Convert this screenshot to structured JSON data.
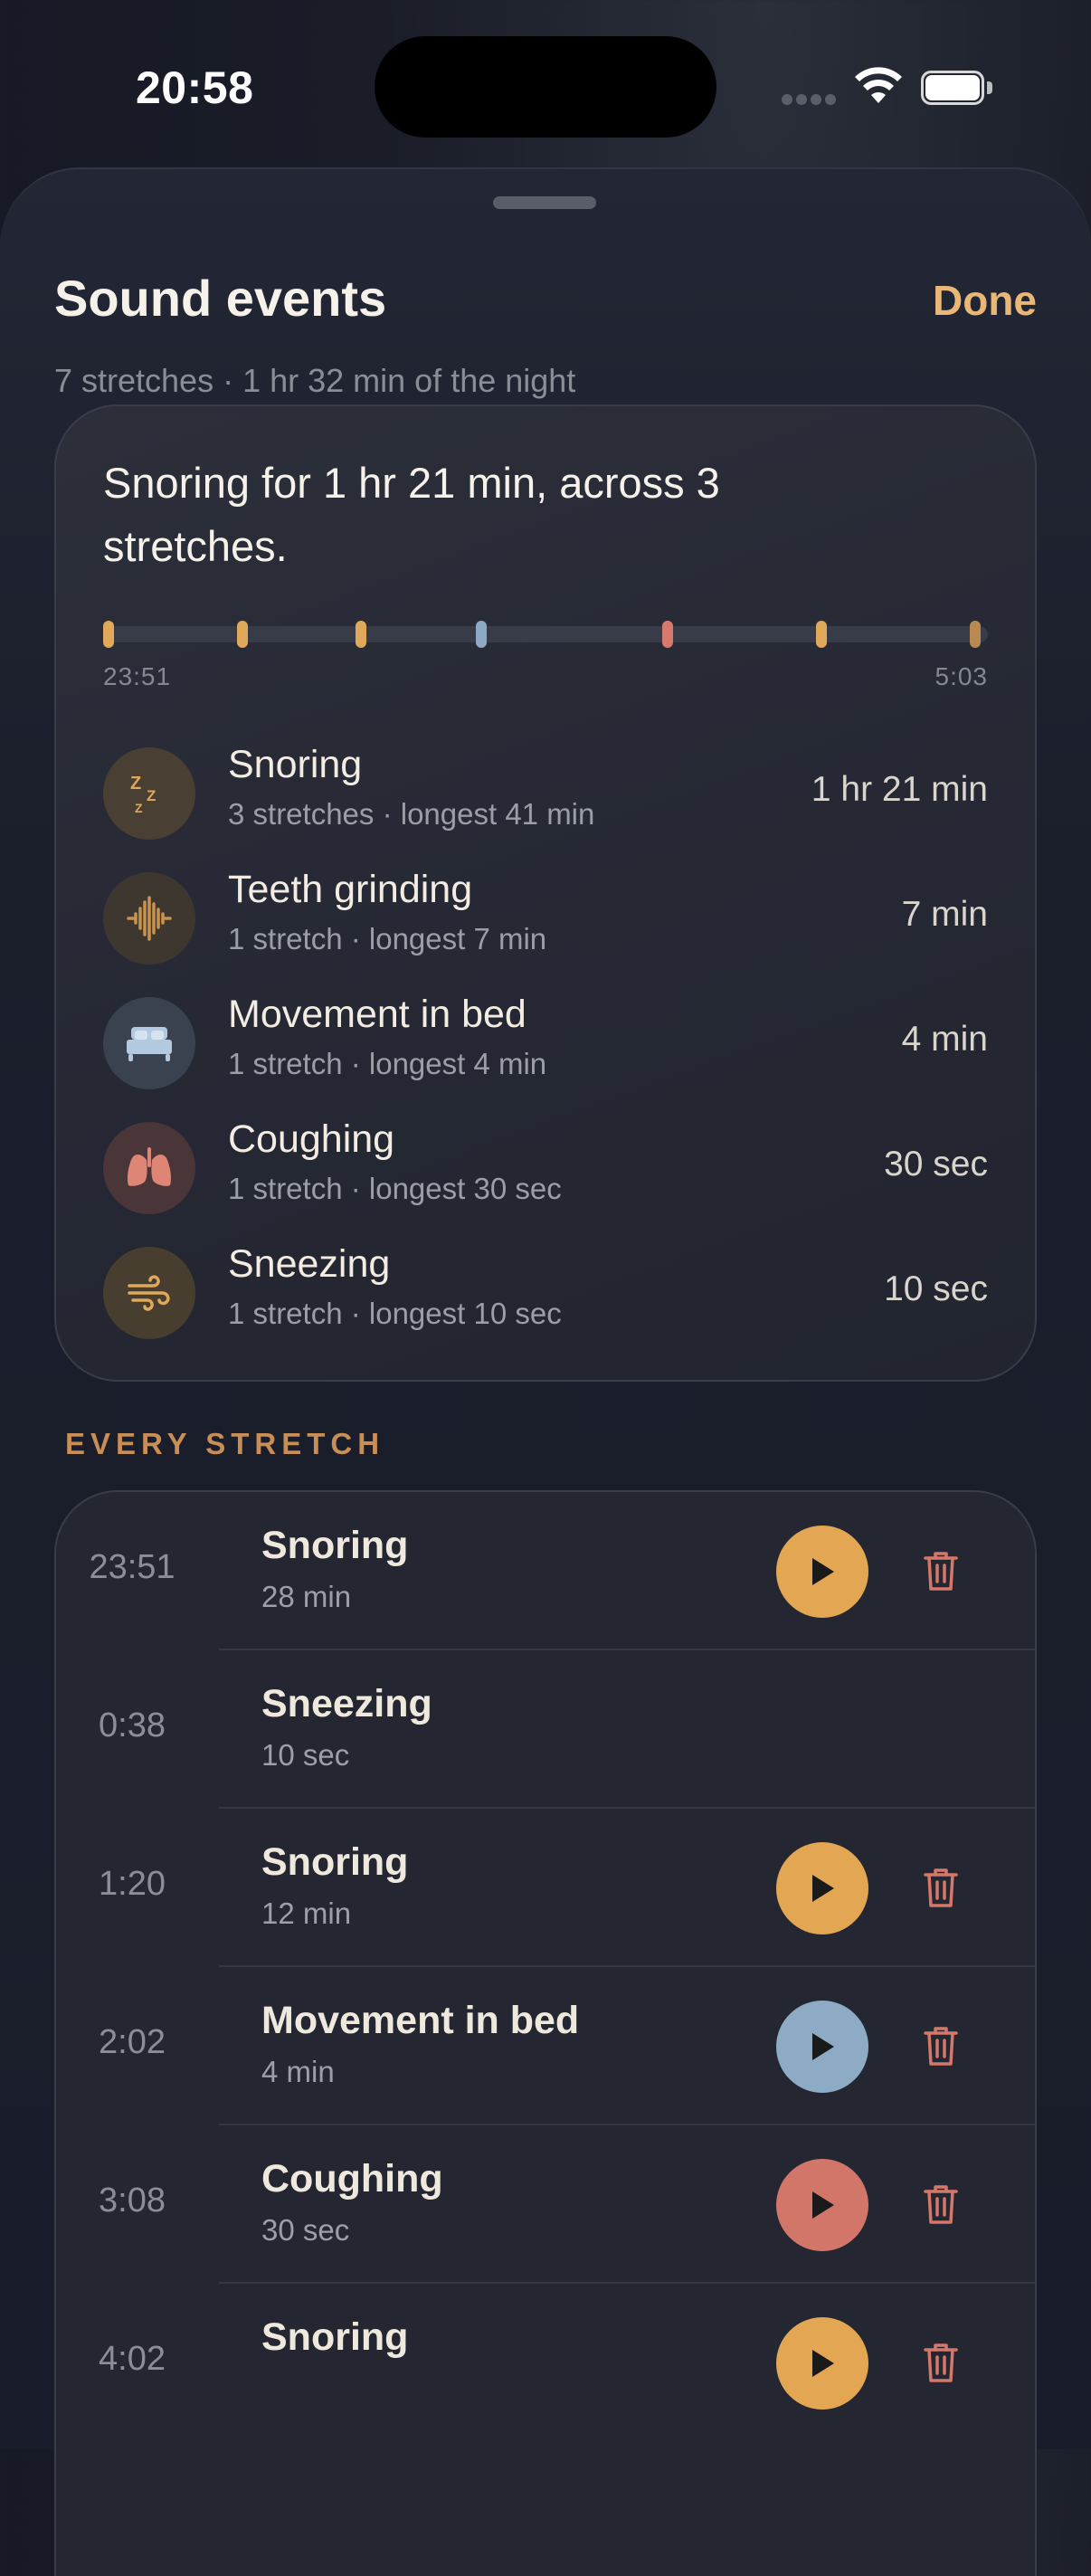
{
  "status_bar": {
    "time": "20:58"
  },
  "sheet": {
    "title": "Sound events",
    "done_label": "Done",
    "subtitle": "7 stretches · 1 hr 32 min of the night"
  },
  "summary": {
    "headline": "Snoring for 1 hr 21 min, across 3 stretches.",
    "timeline": {
      "start_label": "23:51",
      "end_label": "5:03",
      "marks": [
        {
          "type": "Snoring",
          "color": "#e0a95a"
        },
        {
          "type": "Sneezing",
          "color": "#e0a95a"
        },
        {
          "type": "Snoring",
          "color": "#e0a95a"
        },
        {
          "type": "Movement in bed",
          "color": "#8ea9c4"
        },
        {
          "type": "Coughing",
          "color": "#d77a6b"
        },
        {
          "type": "Snoring",
          "color": "#e0a95a"
        },
        {
          "type": "Teeth grinding",
          "color": "#b88a52"
        }
      ]
    },
    "categories": [
      {
        "icon": "zzz-icon",
        "name": "Snoring",
        "meta": "3 stretches · longest 41 min",
        "total": "1 hr 21 min",
        "accent": "#e0a95a",
        "icon_bg": "#4a3f33"
      },
      {
        "icon": "waveform-icon",
        "name": "Teeth grinding",
        "meta": "1 stretch · longest 7 min",
        "total": "7 min",
        "accent": "#c8924f",
        "icon_bg": "#3d372f"
      },
      {
        "icon": "bed-icon",
        "name": "Movement in bed",
        "meta": "1 stretch · longest 4 min",
        "total": "4 min",
        "accent": "#9db7d4",
        "icon_bg": "#3a4250"
      },
      {
        "icon": "lungs-icon",
        "name": "Coughing",
        "meta": "1 stretch · longest 30 sec",
        "total": "30 sec",
        "accent": "#de8575",
        "icon_bg": "#4a3538"
      },
      {
        "icon": "wind-icon",
        "name": "Sneezing",
        "meta": "1 stretch · longest 10 sec",
        "total": "10 sec",
        "accent": "#e0a95a",
        "icon_bg": "#473e30"
      }
    ]
  },
  "stretches_section": {
    "title": "EVERY STRETCH",
    "items": [
      {
        "time": "23:51",
        "name": "Snoring",
        "duration": "28 min",
        "playable": true,
        "play_color": "#e3a652"
      },
      {
        "time": "0:38",
        "name": "Sneezing",
        "duration": "10 sec",
        "playable": false
      },
      {
        "time": "1:20",
        "name": "Snoring",
        "duration": "12 min",
        "playable": true,
        "play_color": "#e3a652"
      },
      {
        "time": "2:02",
        "name": "Movement in bed",
        "duration": "4 min",
        "playable": true,
        "play_color": "#8eabc6"
      },
      {
        "time": "3:08",
        "name": "Coughing",
        "duration": "30 sec",
        "playable": true,
        "play_color": "#d2766a"
      },
      {
        "time": "4:02",
        "name": "Snoring",
        "duration": "",
        "playable": true,
        "play_color": "#e3a652"
      }
    ]
  },
  "colors": {
    "accent": "#e9b877",
    "delete": "#d4786a",
    "section_title": "#c88e55"
  }
}
